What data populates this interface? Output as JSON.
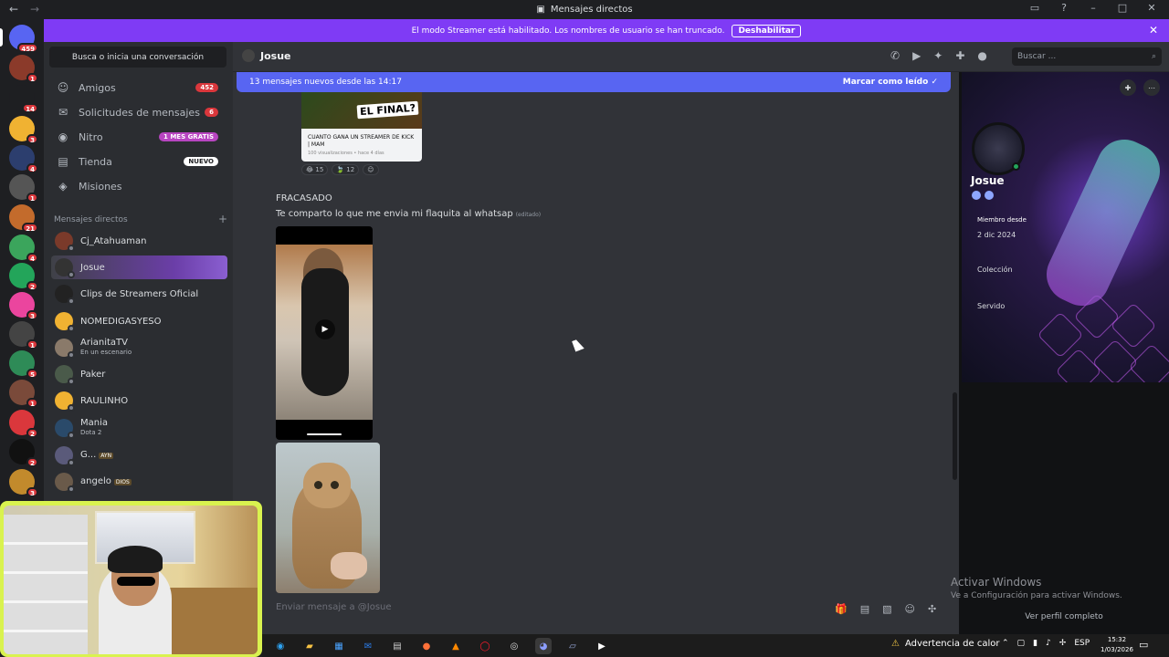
{
  "titlebar": {
    "title": "Mensajes directos"
  },
  "streamer_banner": {
    "text": "El modo Streamer está habilitado. Los nombres de usuario se han truncado.",
    "button": "Deshabilitar"
  },
  "servers": [
    {
      "label": "",
      "badge": "459",
      "color": "#5865f2",
      "icon": "discord-icon"
    },
    {
      "label": "",
      "badge": "1",
      "color": "#8b3a2a"
    },
    {
      "label": "",
      "badge": "14",
      "color": "#1e1f22"
    },
    {
      "label": "",
      "badge": "3",
      "color": "#f0b232"
    },
    {
      "label": "",
      "badge": "4",
      "color": "#2c3e6e"
    },
    {
      "label": "",
      "badge": "1",
      "color": "#555"
    },
    {
      "label": "",
      "badge": "21",
      "color": "#c36b2c"
    },
    {
      "label": "",
      "badge": "4",
      "color": "#3ba55c"
    },
    {
      "label": "",
      "badge": "2",
      "color": "#23a55a"
    },
    {
      "label": "",
      "badge": "3",
      "color": "#eb459e"
    },
    {
      "label": "",
      "badge": "1",
      "color": "#444"
    },
    {
      "label": "",
      "badge": "5",
      "color": "#2e8b57"
    },
    {
      "label": "",
      "badge": "1",
      "color": "#7a4a3a"
    },
    {
      "label": "",
      "badge": "2",
      "color": "#da373c"
    },
    {
      "label": "",
      "badge": "2",
      "color": "#111"
    },
    {
      "label": "",
      "badge": "3",
      "color": "#c28a2c"
    }
  ],
  "dm_panel": {
    "search": "Busca o inicia una conversación",
    "nav": [
      {
        "label": "Amigos",
        "badge": "452",
        "badge_type": "red",
        "icon": "friends-icon"
      },
      {
        "label": "Solicitudes de mensajes",
        "badge": "6",
        "badge_type": "red",
        "icon": "envelope-icon"
      },
      {
        "label": "Nitro",
        "badge": "1 MES GRATIS",
        "badge_type": "purple",
        "icon": "nitro-icon"
      },
      {
        "label": "Tienda",
        "badge": "NUEVO",
        "badge_type": "white",
        "icon": "shop-icon"
      },
      {
        "label": "Misiones",
        "badge": "",
        "badge_type": "",
        "icon": "quest-icon"
      }
    ],
    "dm_header": "Mensajes directos",
    "dms": [
      {
        "name": "Cj_Atahuaman",
        "sub": "",
        "tag": "",
        "color": "#7a3a2a"
      },
      {
        "name": "Josue",
        "sub": "",
        "tag": "",
        "color": "#333"
      },
      {
        "name": "Clips de Streamers Oficial",
        "sub": "",
        "tag": "",
        "color": "#222"
      },
      {
        "name": "NOMEDIGASYESO",
        "sub": "",
        "tag": "",
        "color": "#f0b232"
      },
      {
        "name": "ArianitaTV",
        "sub": "En un escenario",
        "tag": "",
        "color": "#8a7a6a"
      },
      {
        "name": "Paker",
        "sub": "",
        "tag": "",
        "color": "#4a5a4a"
      },
      {
        "name": "RAULINHO",
        "sub": "",
        "tag": "",
        "color": "#f0b232"
      },
      {
        "name": "Mania",
        "sub": "Dota 2",
        "tag": "",
        "color": "#2a4a6a"
      },
      {
        "name": "G...",
        "sub": "",
        "tag": "AYN",
        "color": "#5a5a7a"
      },
      {
        "name": "angelo",
        "sub": "",
        "tag": "DIOS",
        "color": "#6a5a4a"
      }
    ]
  },
  "chat": {
    "recipient": "Josue",
    "search_placeholder": "Buscar ...",
    "new_messages": "13 mensajes nuevos desde las 14:17",
    "mark_read": "Marcar como leído",
    "card": {
      "overlay": "EL FINAL?",
      "title": "CUANTO GANA UN STREAMER DE KICK | MAM",
      "sub": "100 visualizaciones • hace 4 días"
    },
    "reactions": [
      {
        "emoji": "😂",
        "count": "15"
      },
      {
        "emoji": "🍃",
        "count": "12"
      },
      {
        "emoji": "☺",
        "count": ""
      }
    ],
    "messages": [
      {
        "text": "FRACASADO",
        "edited": ""
      },
      {
        "text": "Te comparto lo que me envia mi flaquita al whatsap",
        "edited": "(editado)"
      }
    ],
    "composer_placeholder": "Enviar mensaje a @Josue"
  },
  "profile": {
    "name": "Josue",
    "member_since_label": "Miembro desde",
    "member_since": "2 dic 2024",
    "collection": "Colección",
    "servers": "Servido",
    "full_profile": "Ver perfil completo"
  },
  "windows_watermark": {
    "title": "Activar Windows",
    "sub": "Ve a Configuración para activar Windows."
  },
  "taskbar": {
    "warning": "Advertencia de calor",
    "lang": "ESP",
    "time": "15:32",
    "date": "1/03/2026"
  }
}
